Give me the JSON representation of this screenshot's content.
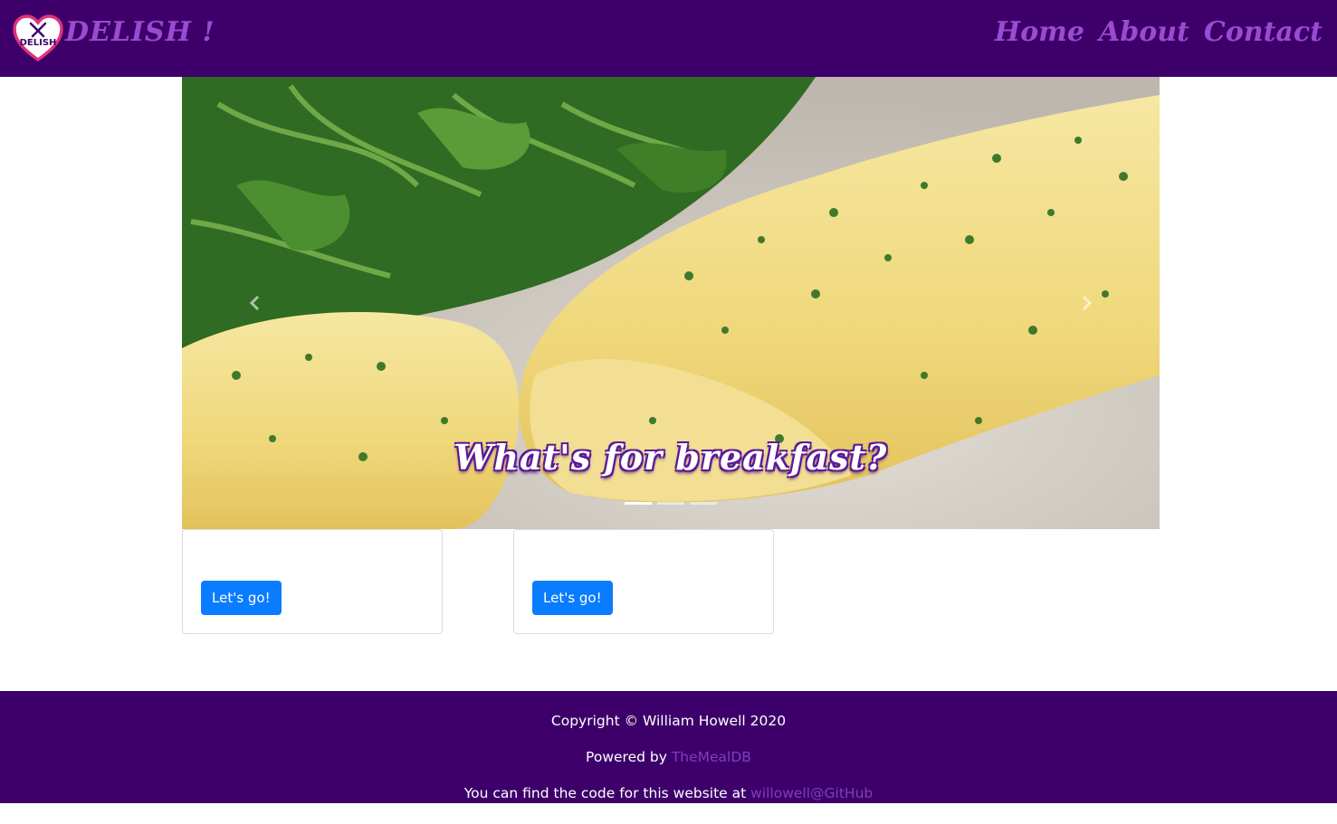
{
  "navbar": {
    "brand": "DELISH !",
    "logo_text": "DELISH",
    "links": [
      {
        "label": "Home"
      },
      {
        "label": "About"
      },
      {
        "label": "Contact"
      }
    ]
  },
  "carousel": {
    "caption": "What's for breakfast?",
    "prev_icon": "chevron-left-icon",
    "next_icon": "chevron-right-icon",
    "slide_count": 3,
    "active_index": 0
  },
  "cards": [
    {
      "title": "",
      "button_label": "Let's go!"
    },
    {
      "title": "",
      "button_label": "Let's go!"
    }
  ],
  "footer": {
    "copyright": "Copyright © William Howell 2020",
    "powered_prefix": "Powered by ",
    "powered_link": "TheMealDB",
    "code_prefix": "You can find the code for this website at ",
    "code_link": "willowell@GitHub"
  },
  "colors": {
    "nav_bg": "#3d006b",
    "accent_purple": "#9a4bd0",
    "button_blue": "#0a7cff"
  }
}
